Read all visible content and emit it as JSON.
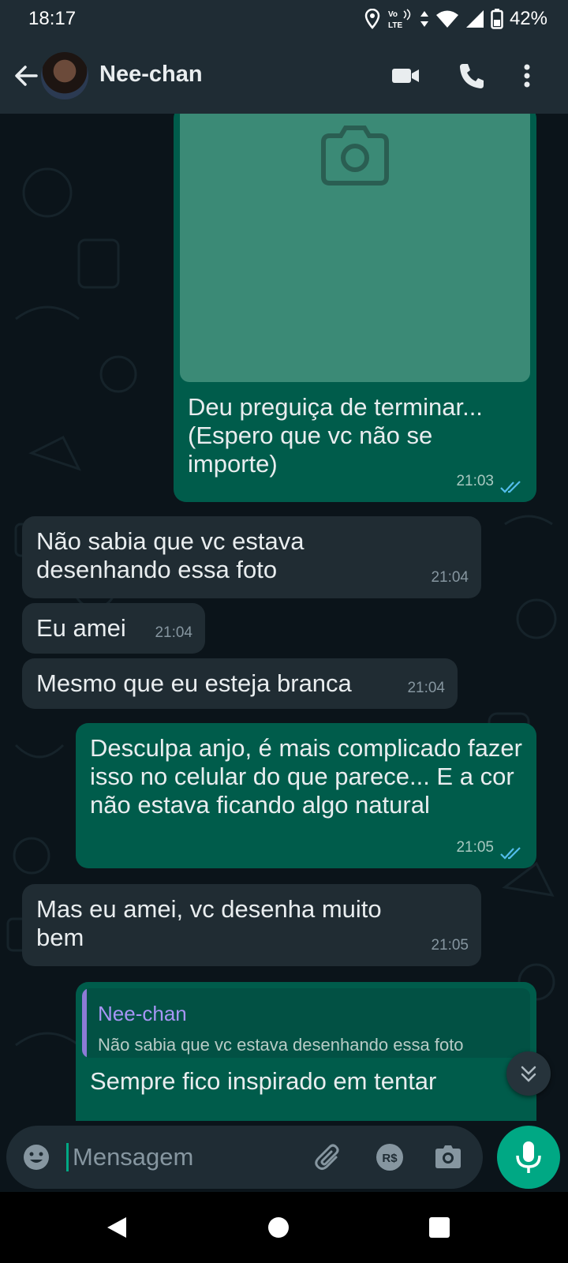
{
  "status_bar": {
    "time": "18:17",
    "volte": "Vo LTE",
    "battery_percent": "42%",
    "icons": [
      "location-icon",
      "volte-icon",
      "data-arrows-icon",
      "wifi-icon",
      "signal-icon",
      "battery-icon"
    ]
  },
  "header": {
    "contact_name": "Nee-chan",
    "icons": [
      "back-arrow-icon",
      "video-call-icon",
      "voice-call-icon",
      "more-vert-icon"
    ]
  },
  "messages": [
    {
      "direction": "out",
      "has_image": true,
      "text": "Deu preguiça de terminar... (Espero que vc não se importe)",
      "time": "21:03",
      "status": "read"
    },
    {
      "direction": "in",
      "text": "Não sabia que vc estava desenhando essa foto",
      "time": "21:04"
    },
    {
      "direction": "in",
      "text": "Eu amei",
      "time": "21:04"
    },
    {
      "direction": "in",
      "text": "Mesmo que eu esteja branca",
      "time": "21:04"
    },
    {
      "direction": "out",
      "text": "Desculpa anjo, é mais complicado fazer isso no celular do que parece... E a cor não estava ficando algo natural",
      "time": "21:05",
      "status": "read"
    },
    {
      "direction": "in",
      "text": "Mas eu amei, vc desenha muito bem",
      "time": "21:05"
    },
    {
      "direction": "out",
      "quote": {
        "name": "Nee-chan",
        "text": "Não sabia que vc estava desenhando essa foto"
      },
      "text": "Sempre fico inspirado em tentar"
    }
  ],
  "input": {
    "placeholder": "Mensagem",
    "icons": [
      "emoji-icon",
      "attach-icon",
      "payment-icon",
      "camera-icon",
      "mic-icon"
    ]
  },
  "nav": {
    "icons": [
      "nav-back-icon",
      "nav-home-icon",
      "nav-recents-icon"
    ]
  },
  "colors": {
    "background": "#0b141a",
    "header": "#1f2c34",
    "incoming_bubble": "#202c33",
    "outgoing_bubble": "#005c4b",
    "accent": "#00a884",
    "read_ticks": "#53bdeb",
    "quote_name": "#a795f5"
  }
}
